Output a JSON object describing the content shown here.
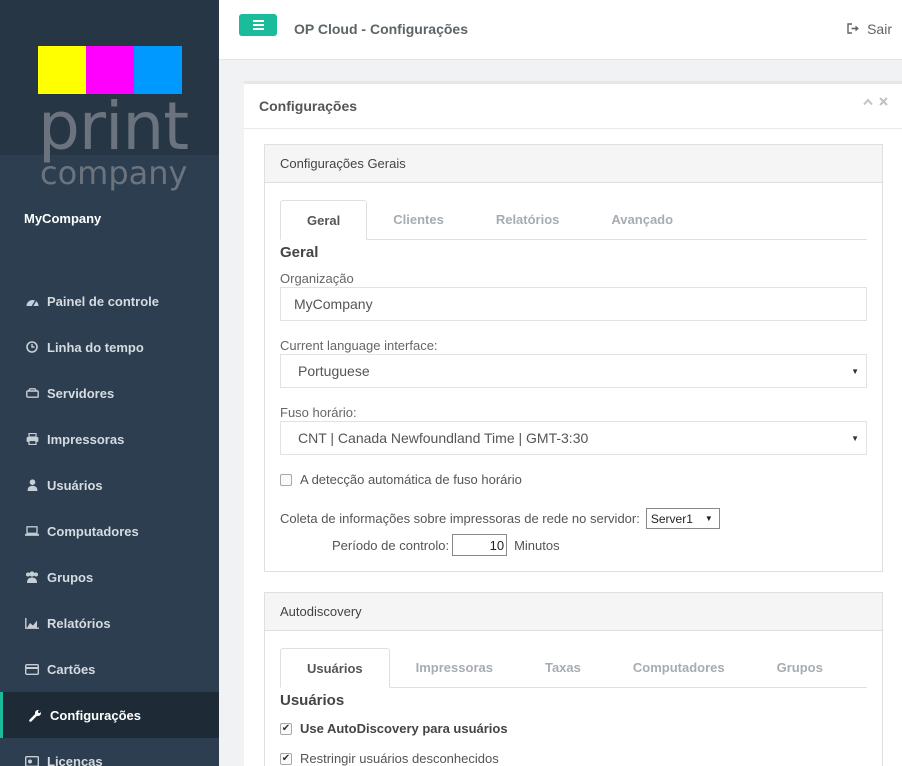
{
  "app": {
    "title": "OP Cloud - Configurações",
    "logout_label": "Sair",
    "accent": "#1abc9c"
  },
  "logo": {
    "squares": [
      "#ffff00",
      "#ff00ff",
      "#0099ff"
    ],
    "line1": "print",
    "line2": "company"
  },
  "sidebar": {
    "company": "MyCompany",
    "items": [
      {
        "label": "Painel de controle",
        "icon": "dashboard-icon"
      },
      {
        "label": "Linha do tempo",
        "icon": "clock-icon"
      },
      {
        "label": "Servidores",
        "icon": "server-icon"
      },
      {
        "label": "Impressoras",
        "icon": "printer-icon"
      },
      {
        "label": "Usuários",
        "icon": "user-icon"
      },
      {
        "label": "Computadores",
        "icon": "laptop-icon"
      },
      {
        "label": "Grupos",
        "icon": "users-icon"
      },
      {
        "label": "Relatórios",
        "icon": "area-chart-icon"
      },
      {
        "label": "Cartões",
        "icon": "card-icon"
      },
      {
        "label": "Configurações",
        "icon": "wrench-icon",
        "active": true
      },
      {
        "label": "Licenças",
        "icon": "license-icon"
      }
    ]
  },
  "panel": {
    "title": "Configurações"
  },
  "general": {
    "title": "Configurações Gerais",
    "tabs": [
      "Geral",
      "Clientes",
      "Relatórios",
      "Avançado"
    ],
    "active_tab": "Geral",
    "section_title": "Geral",
    "org_label": "Organização",
    "org_value": "MyCompany",
    "lang_label": "Current language interface:",
    "lang_value": "Portuguese",
    "tz_label": "Fuso horário:",
    "tz_value": "CNT | Canada Newfoundland Time | GMT-3:30",
    "auto_tz_label": "A detecção automática de fuso horário",
    "auto_tz_checked": false,
    "collect_label": "Coleta de informações sobre impressoras de rede no servidor:",
    "server_value": "Server1",
    "period_label": "Período de controlo:",
    "period_value": "10",
    "period_unit": "Minutos"
  },
  "autodiscovery": {
    "title": "Autodiscovery",
    "tabs": [
      "Usuários",
      "Impressoras",
      "Taxas",
      "Computadores",
      "Grupos"
    ],
    "active_tab": "Usuários",
    "section_title": "Usuários",
    "use_label": "Use AutoDiscovery para usuários",
    "use_checked": true,
    "restrict_label": "Restringir usuários desconhecidos",
    "restrict_checked": true
  }
}
